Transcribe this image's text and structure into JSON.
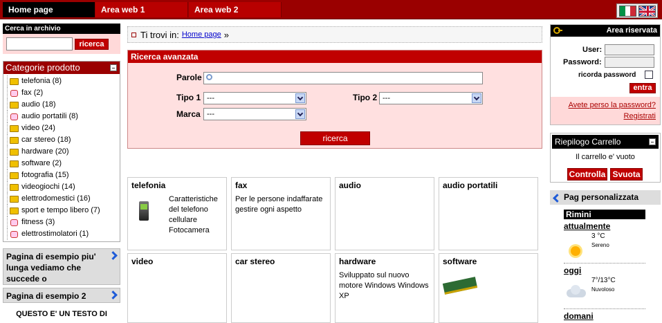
{
  "topbar": {
    "tabs": [
      {
        "label": "Home page"
      },
      {
        "label": "Area web 1"
      },
      {
        "label": "Area web 2"
      }
    ],
    "flag_italy_colors": [
      "#009246",
      "#ffffff",
      "#ce2b37"
    ],
    "flag_uk_color": "#1e3a8a"
  },
  "search": {
    "title": "Cerca in archivio",
    "value": "",
    "button": "ricerca"
  },
  "categories": {
    "title": "Categorie prodotto",
    "items": [
      {
        "label": "telefonia (8)",
        "icon": "folder-icon"
      },
      {
        "label": "fax (2)",
        "icon": "leaf-icon"
      },
      {
        "label": "audio (18)",
        "icon": "folder-icon"
      },
      {
        "label": "audio portatili (8)",
        "icon": "leaf-icon"
      },
      {
        "label": "video (24)",
        "icon": "folder-icon"
      },
      {
        "label": "car stereo (18)",
        "icon": "folder-icon"
      },
      {
        "label": "hardware (20)",
        "icon": "folder-icon"
      },
      {
        "label": "software (2)",
        "icon": "folder-icon"
      },
      {
        "label": "fotografia (15)",
        "icon": "folder-icon"
      },
      {
        "label": "videogiochi (14)",
        "icon": "folder-icon"
      },
      {
        "label": "elettrodomestici (16)",
        "icon": "folder-icon"
      },
      {
        "label": "sport e tempo libero (7)",
        "icon": "folder-icon"
      },
      {
        "label": "fitness (3)",
        "icon": "leaf-icon"
      },
      {
        "label": "elettrostimolatori (1)",
        "icon": "leaf-icon"
      }
    ]
  },
  "left_pages": [
    {
      "label": "Pagina di esempio piu' lunga vediamo che succede o"
    },
    {
      "label": "Pagina di esempio 2"
    }
  ],
  "left_text": "QUESTO E' UN TESTO DI",
  "breadcrumb": {
    "prefix": "Ti trovi in:",
    "link": "Home page",
    "sep": "»"
  },
  "advanced_search": {
    "title": "Ricerca avanzata",
    "words_label": "Parole",
    "words_value": "",
    "tipo1_label": "Tipo 1",
    "tipo1_value": "---",
    "tipo2_label": "Tipo 2",
    "tipo2_value": "---",
    "marca_label": "Marca",
    "marca_value": "---",
    "button": "ricerca"
  },
  "tiles": [
    {
      "title": "telefonia",
      "desc": "Caratteristiche del telefono cellulare Fotocamera",
      "icon": "phone-icon"
    },
    {
      "title": "fax",
      "desc": "Per le persone indaffarate gestire ogni aspetto",
      "icon": ""
    },
    {
      "title": "audio",
      "desc": "",
      "icon": ""
    },
    {
      "title": "audio portatili",
      "desc": "",
      "icon": ""
    },
    {
      "title": "video",
      "desc": "",
      "icon": ""
    },
    {
      "title": "car stereo",
      "desc": "",
      "icon": ""
    },
    {
      "title": "hardware",
      "desc": "Sviluppato sul nuovo motore Windows Windows XP",
      "icon": ""
    },
    {
      "title": "software",
      "desc": "",
      "icon": "ram-icon"
    }
  ],
  "login": {
    "title": "Area riservata",
    "user_label": "User:",
    "user_value": "",
    "password_label": "Password:",
    "password_value": "",
    "remember_label": "ricorda password",
    "remember_checked": false,
    "button": "entra",
    "forgot_link": "Avete perso la password?",
    "register_link": "Registrati"
  },
  "cart": {
    "title": "Riepilogo Carrello",
    "message": "Il carrello e' vuoto",
    "check_button": "Controlla",
    "empty_button": "Svuota"
  },
  "custom_page": {
    "title": "Pag personalizzata",
    "city": "Rimini",
    "forecasts": [
      {
        "label": "attualmente",
        "temp": "3 °C",
        "condition": "Sereno",
        "icon": "sun-icon"
      },
      {
        "label": "oggi",
        "temp": "7°/13°C",
        "condition": "Nuvoloso",
        "icon": "cloud-icon"
      },
      {
        "label": "domani",
        "temp": "",
        "condition": "",
        "icon": ""
      }
    ]
  },
  "colors": {
    "brand_red": "#9a0000",
    "button_red": "#c00000",
    "panel_pink": "#ffe0e0",
    "link_blue": "#0000cc"
  }
}
